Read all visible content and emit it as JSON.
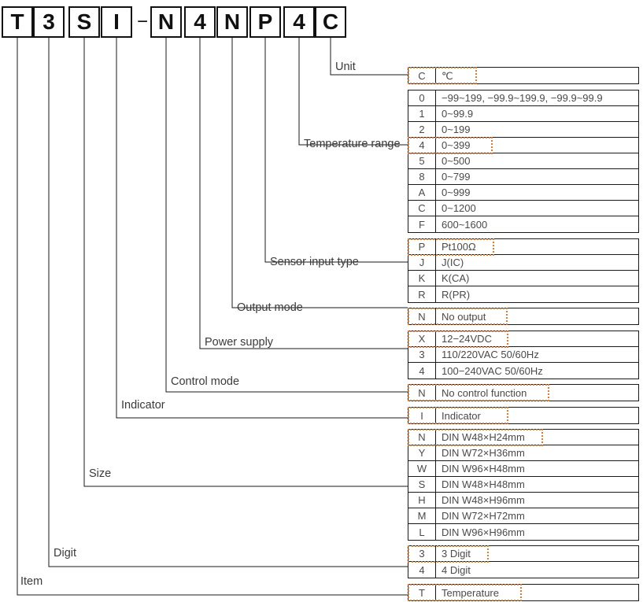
{
  "model_code": {
    "label": "model-code",
    "segments": [
      {
        "char": "T",
        "type": "box"
      },
      {
        "char": "3",
        "type": "box"
      },
      {
        "char": "S",
        "type": "box"
      },
      {
        "char": "I",
        "type": "box"
      },
      {
        "char": "−",
        "type": "dash"
      },
      {
        "char": "N",
        "type": "box"
      },
      {
        "char": "4",
        "type": "box"
      },
      {
        "char": "N",
        "type": "box"
      },
      {
        "char": "P",
        "type": "box"
      },
      {
        "char": "4",
        "type": "box"
      },
      {
        "char": "C",
        "type": "box"
      }
    ]
  },
  "categories": {
    "unit": "Unit",
    "temperature_range": "Temperature range",
    "sensor_input_type": "Sensor input type",
    "output_mode": "Output mode",
    "power_supply": "Power supply",
    "control_mode": "Control mode",
    "indicator": "Indicator",
    "size": "Size",
    "digit": "Digit",
    "item": "Item"
  },
  "highlight_color": "#e07b2e",
  "groups": {
    "unit": {
      "rows": [
        {
          "code": "C",
          "desc": "℃",
          "highlight": true,
          "hl_width": 88
        }
      ]
    },
    "temperature_range": {
      "rows": [
        {
          "code": "0",
          "desc": "−99~199, −99.9~199.9, −99.9~99.9",
          "highlight": false
        },
        {
          "code": "1",
          "desc": "0~99.9",
          "highlight": false
        },
        {
          "code": "2",
          "desc": "0~199",
          "highlight": false
        },
        {
          "code": "4",
          "desc": "0~399",
          "highlight": true,
          "hl_width": 108
        },
        {
          "code": "5",
          "desc": "0~500",
          "highlight": false
        },
        {
          "code": "8",
          "desc": "0~799",
          "highlight": false
        },
        {
          "code": "A",
          "desc": "0~999",
          "highlight": false
        },
        {
          "code": "C",
          "desc": "0~1200",
          "highlight": false
        },
        {
          "code": "F",
          "desc": "600~1600",
          "highlight": false
        }
      ]
    },
    "sensor_input_type": {
      "rows": [
        {
          "code": "P",
          "desc": "Pt100Ω",
          "highlight": true,
          "hl_width": 110
        },
        {
          "code": "J",
          "desc": "J(IC)",
          "highlight": false
        },
        {
          "code": "K",
          "desc": "K(CA)",
          "highlight": false
        },
        {
          "code": "R",
          "desc": "R(PR)",
          "highlight": false
        }
      ]
    },
    "output_mode": {
      "rows": [
        {
          "code": "N",
          "desc": "No output",
          "highlight": true,
          "hl_width": 127
        }
      ]
    },
    "power_supply": {
      "rows": [
        {
          "code": "X",
          "desc": "12−24VDC",
          "highlight": true,
          "hl_width": 128
        },
        {
          "code": "3",
          "desc": "110/220VAC 50/60Hz",
          "highlight": false
        },
        {
          "code": "4",
          "desc": "100−240VAC 50/60Hz",
          "highlight": false
        }
      ]
    },
    "control_mode": {
      "rows": [
        {
          "code": "N",
          "desc": "No control function",
          "highlight": true,
          "hl_width": 180
        }
      ]
    },
    "indicator": {
      "rows": [
        {
          "code": "I",
          "desc": "Indicator",
          "highlight": true,
          "hl_width": 128
        }
      ]
    },
    "size": {
      "rows": [
        {
          "code": "N",
          "desc": "DIN W48×H24mm",
          "highlight": true,
          "hl_width": 172
        },
        {
          "code": "Y",
          "desc": "DIN W72×H36mm",
          "highlight": false
        },
        {
          "code": "W",
          "desc": "DIN W96×H48mm",
          "highlight": false
        },
        {
          "code": "S",
          "desc": "DIN W48×H48mm",
          "highlight": false
        },
        {
          "code": "H",
          "desc": "DIN W48×H96mm",
          "highlight": false
        },
        {
          "code": "M",
          "desc": "DIN W72×H72mm",
          "highlight": false
        },
        {
          "code": "L",
          "desc": "DIN W96×H96mm",
          "highlight": false
        }
      ]
    },
    "digit": {
      "rows": [
        {
          "code": "3",
          "desc": "3 Digit",
          "highlight": true,
          "hl_width": 103
        },
        {
          "code": "4",
          "desc": "4 Digit",
          "highlight": false
        }
      ]
    },
    "item": {
      "rows": [
        {
          "code": "T",
          "desc": "Temperature",
          "highlight": true,
          "hl_width": 145
        }
      ]
    }
  }
}
